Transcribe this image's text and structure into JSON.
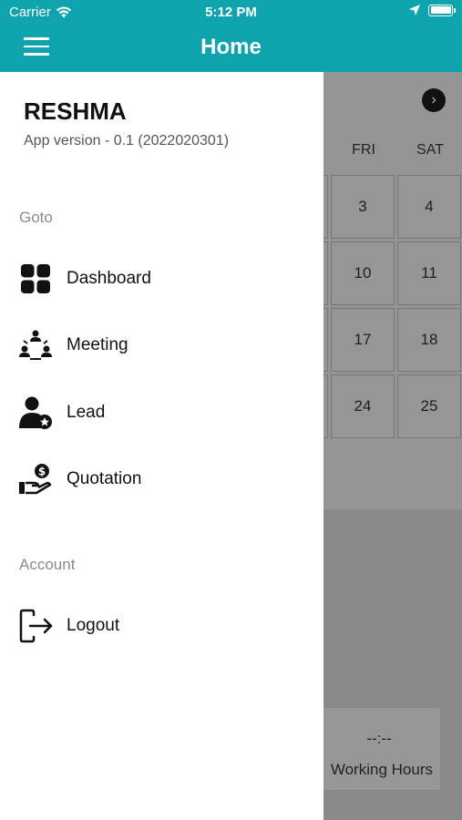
{
  "status_bar": {
    "carrier": "Carrier",
    "time": "5:12 PM"
  },
  "header": {
    "title": "Home",
    "menu_icon": "hamburger-icon"
  },
  "drawer": {
    "user_name": "RESHMA",
    "app_version": "App version - 0.1 (2022020301)",
    "sections": [
      {
        "label": "Goto",
        "items": [
          {
            "label": "Dashboard",
            "icon": "dashboard-grid-icon"
          },
          {
            "label": "Meeting",
            "icon": "meeting-group-icon"
          },
          {
            "label": "Lead",
            "icon": "lead-user-icon"
          },
          {
            "label": "Quotation",
            "icon": "quotation-hand-dollar-icon"
          }
        ]
      },
      {
        "label": "Account",
        "items": [
          {
            "label": "Logout",
            "icon": "logout-icon"
          }
        ]
      }
    ]
  },
  "background": {
    "weekdays": [
      "FRI",
      "SAT"
    ],
    "calendar_rows": [
      [
        "3",
        "4"
      ],
      [
        "10",
        "11"
      ],
      [
        "17",
        "18"
      ],
      [
        "24",
        "25"
      ]
    ],
    "working_hours": {
      "value": "--:--",
      "label": "Working Hours"
    }
  }
}
